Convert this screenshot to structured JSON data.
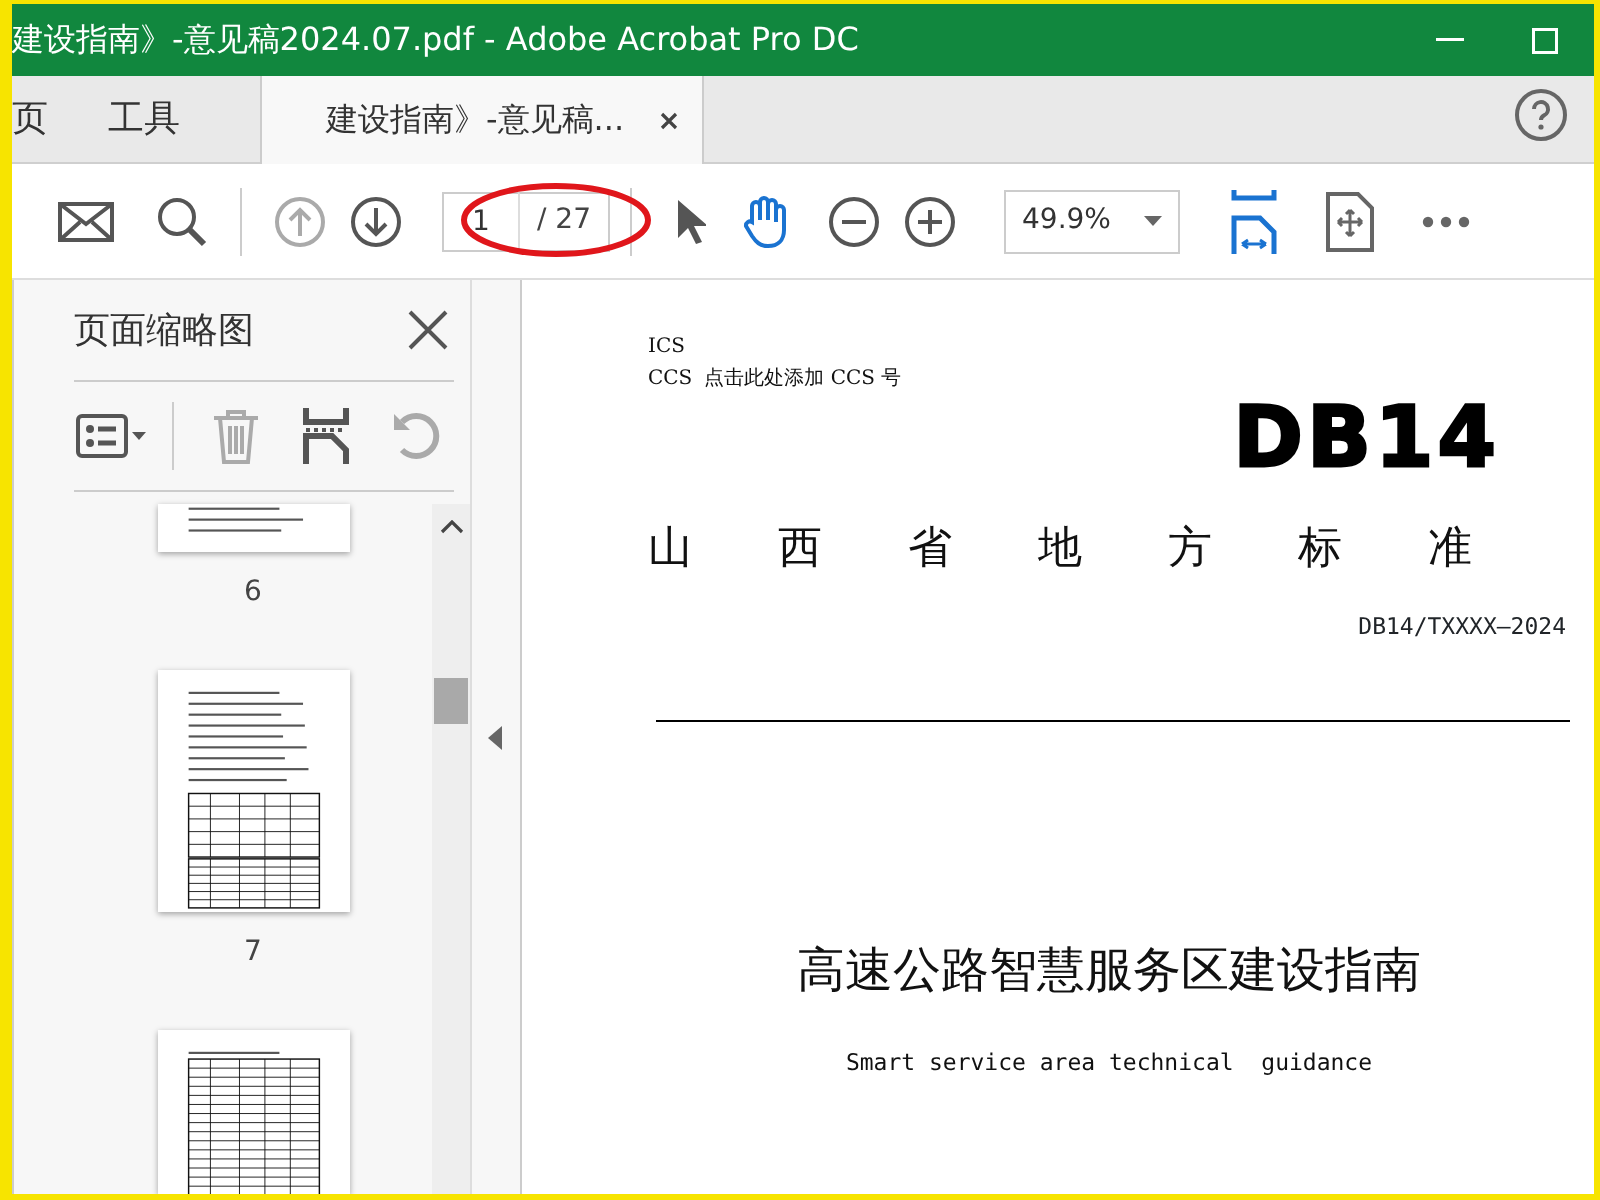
{
  "window": {
    "title": "建设指南》-意见稿2024.07.pdf - Adobe Acrobat Pro DC"
  },
  "tabs": [
    {
      "label": "页",
      "kind": "nav",
      "selected": false
    },
    {
      "label": "工具",
      "kind": "nav",
      "selected": false
    },
    {
      "label": "建设指南》-意见稿...",
      "kind": "document",
      "selected": true
    }
  ],
  "toolbar": {
    "page_number": "1",
    "page_total": "/ 27",
    "zoom": "49.9%"
  },
  "thumbnails_panel": {
    "title": "页面缩略图",
    "pages": [
      {
        "label": "6",
        "kind": "cut_top"
      },
      {
        "label": "7",
        "kind": "full"
      },
      {
        "kind": "cut_bottom"
      }
    ]
  },
  "document": {
    "ics": "ICS",
    "ccs_label": "CCS",
    "ccs_hint": "点击此处添加 CCS 号",
    "code": "DB14",
    "standard_type": "山西省地方标准",
    "number": "DB14/TXXXX—2024",
    "title": "高速公路智慧服务区建设指南",
    "subtitle": "Smart service area technical  guidance"
  }
}
